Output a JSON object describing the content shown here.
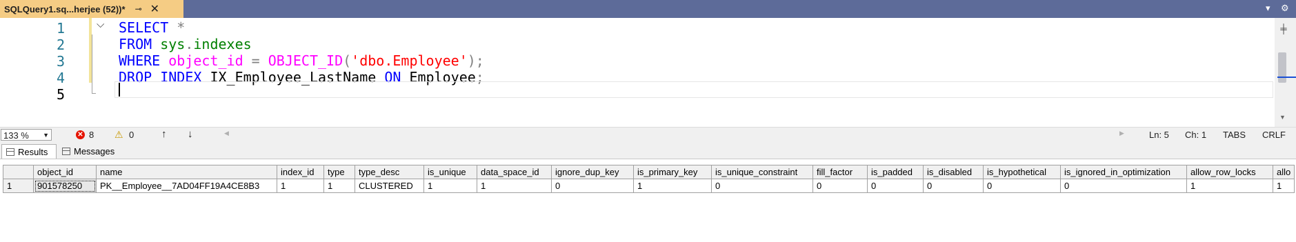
{
  "tab": {
    "title": "SQLQuery1.sq...herjee (52))*",
    "pin_icon": "pin-icon",
    "close_icon": "close-icon"
  },
  "editor": {
    "line_numbers": [
      "1",
      "2",
      "3",
      "4",
      "5"
    ],
    "lines": [
      [
        {
          "t": "SELECT ",
          "c": "kw"
        },
        {
          "t": "*",
          "c": "gray"
        }
      ],
      [
        {
          "t": "FROM ",
          "c": "kw"
        },
        {
          "t": "sys",
          "c": "obj"
        },
        {
          "t": ".",
          "c": "gray"
        },
        {
          "t": "indexes",
          "c": "obj"
        }
      ],
      [
        {
          "t": "WHERE ",
          "c": "kw"
        },
        {
          "t": "object_id",
          "c": "fn"
        },
        {
          "t": " = ",
          "c": "gray"
        },
        {
          "t": "OBJECT_ID",
          "c": "fn"
        },
        {
          "t": "(",
          "c": "gray"
        },
        {
          "t": "'dbo.Employee'",
          "c": "str"
        },
        {
          "t": ");",
          "c": "gray"
        }
      ],
      [
        {
          "t": "DROP INDEX ",
          "c": "kw"
        },
        {
          "t": "IX_Employee_LastName ",
          "c": ""
        },
        {
          "t": "ON ",
          "c": "kw"
        },
        {
          "t": "Employee",
          "c": ""
        },
        {
          "t": ";",
          "c": "gray"
        }
      ],
      []
    ]
  },
  "status": {
    "zoom": "133 %",
    "errors": "8",
    "warnings": "0",
    "ln": "Ln: 5",
    "ch": "Ch: 1",
    "tabs": "TABS",
    "eol": "CRLF"
  },
  "results_tabs": {
    "results": "Results",
    "messages": "Messages"
  },
  "grid": {
    "columns": [
      "object_id",
      "name",
      "index_id",
      "type",
      "type_desc",
      "is_unique",
      "data_space_id",
      "ignore_dup_key",
      "is_primary_key",
      "is_unique_constraint",
      "fill_factor",
      "is_padded",
      "is_disabled",
      "is_hypothetical",
      "is_ignored_in_optimization",
      "allow_row_locks",
      "allo"
    ],
    "rows": [
      {
        "num": "1",
        "cells": [
          "901578250",
          "PK__Employee__7AD04FF19A4CE8B3",
          "1",
          "1",
          "CLUSTERED",
          "1",
          "1",
          "0",
          "1",
          "0",
          "0",
          "0",
          "0",
          "0",
          "0",
          "1",
          "1"
        ]
      }
    ]
  }
}
